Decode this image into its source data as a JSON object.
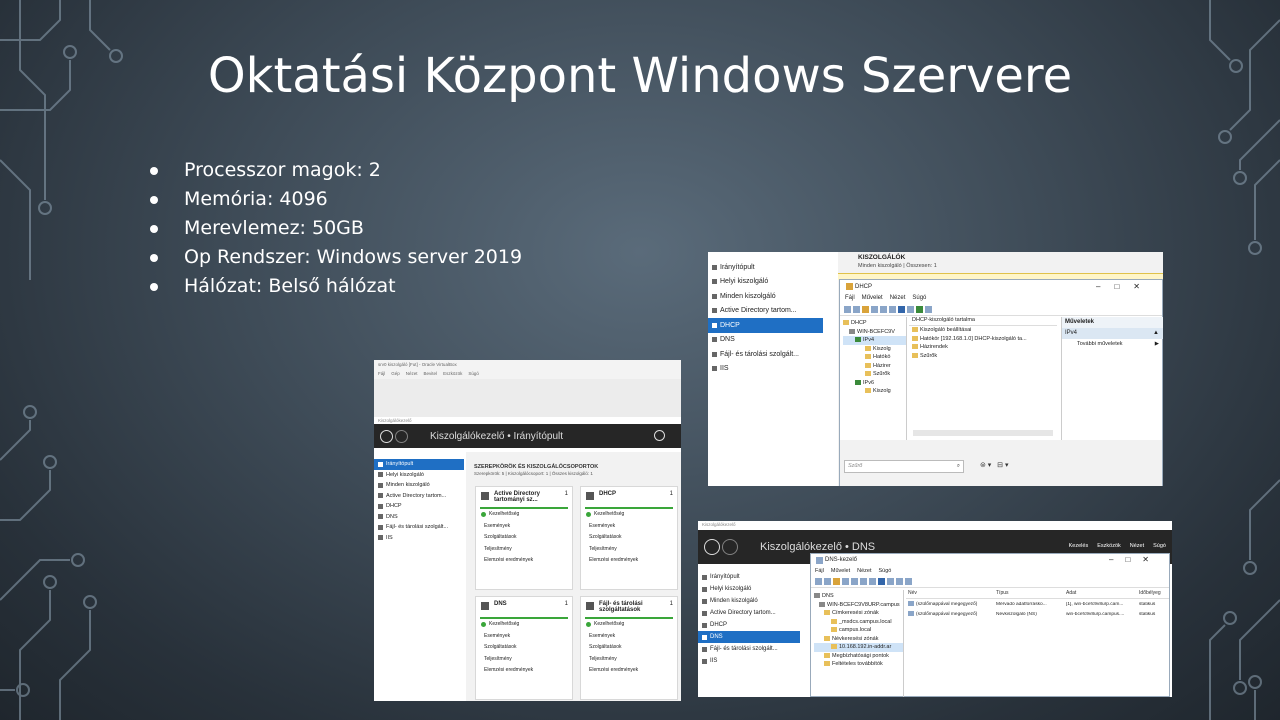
{
  "slide": {
    "title": "Oktatási Központ Windows Szervere",
    "bullets": [
      "Processzor magok: 2",
      "Memória: 4096",
      "Merevlemez: 50GB",
      "Op Rendszer: Windows server 2019",
      "Hálózat: Belső hálózat"
    ]
  },
  "shot1": {
    "vbox_title": "srv0 kiszolgáló [Fut] - Oracle VirtualBox",
    "vbox_menu": [
      "Fájl",
      "Gép",
      "Nézet",
      "Bevitel",
      "Eszközök",
      "Súgó"
    ],
    "sm_title_small": "Kiszolgálókezelő",
    "breadcrumb": "Kiszolgálókezelő • Irányítópult",
    "nav": [
      "Irányítópult",
      "Helyi kiszolgáló",
      "Minden kiszolgáló",
      "Active Directory tartom...",
      "DHCP",
      "DNS",
      "Fájl- és tárolási szolgált...",
      "IIS"
    ],
    "section_title": "SZEREPKÖRÖK ÉS KISZOLGÁLÓCSOPORTOK",
    "section_sub": "Szerepkörök: 5 | Kiszolgálócsoport: 1 | Összes kiszolgáló: 1",
    "tiles": [
      {
        "name": "Active Directory tartományi sz...",
        "count": "1"
      },
      {
        "name": "DHCP",
        "count": "1"
      },
      {
        "name": "DNS",
        "count": "1"
      },
      {
        "name": "Fájl- és tárolási szolgáltatások",
        "count": "1"
      }
    ],
    "tile_rows": [
      "Kezelhetőség",
      "Események",
      "Szolgáltatások",
      "Teljesítmény",
      "Elemzési eredmények"
    ]
  },
  "shot2": {
    "nav": [
      "Irányítópult",
      "Helyi kiszolgáló",
      "Minden kiszolgáló",
      "Active Directory tartom...",
      "DHCP",
      "DNS",
      "Fájl- és tárolási szolgált...",
      "IIS"
    ],
    "header_title": "KISZOLGÁLÓK",
    "header_sub": "Minden kiszolgáló | Összesen: 1",
    "dhcp_title": "DHCP",
    "menu": [
      "Fájl",
      "Művelet",
      "Nézet",
      "Súgó"
    ],
    "tree": [
      "DHCP",
      "WIN-BCEFC9V",
      "IPv4",
      "Kiszolg",
      "Hatókö",
      "Házirer",
      "Szűrők",
      "IPv6",
      "Kiszolg"
    ],
    "content_header": "DHCP-kiszolgáló tartalma",
    "content_rows": [
      "Kiszolgáló beállításai",
      "Hatókör [192.168.1.0] DHCP-kiszolgáló ta...",
      "Házirendek",
      "Szűrők"
    ],
    "actions_header": "Műveletek",
    "actions_sel": "IPv4",
    "actions_more": "További műveletek",
    "filter_placeholder": "Szűrő"
  },
  "shot3": {
    "sm_title_small": "Kiszolgálókezelő",
    "breadcrumb": "Kiszolgálókezelő • DNS",
    "top_menu": [
      "Kezelés",
      "Eszközök",
      "Nézet",
      "Súgó"
    ],
    "nav": [
      "Irányítópult",
      "Helyi kiszolgáló",
      "Minden kiszolgáló",
      "Active Directory tartom...",
      "DHCP",
      "DNS",
      "Fájl- és tárolási szolgált...",
      "IIS"
    ],
    "dns_title": "DNS-kezelő",
    "menu": [
      "Fájl",
      "Művelet",
      "Nézet",
      "Súgó"
    ],
    "tree": [
      "DNS",
      "WIN-BCEFC9V8URP.campus",
      "Címkeresési zónák",
      "_msdcs.campus.local",
      "campus.local",
      "Névkeresési zónák",
      "10.168.192.in-addr.ar",
      "Megbízhatósági pontok",
      "Feltételes továbbítók"
    ],
    "cols": [
      "Név",
      "Típus",
      "Adat",
      "Időbélyeg"
    ],
    "rows": [
      [
        "(szülőmappával megegyező)",
        "Mérvadó adatforrásko...",
        "[1], win-bcefc9v8urp.cam...",
        "statikus"
      ],
      [
        "(szülőmappával megegyező)",
        "Névkiszolgáló (NS)",
        "win-bcefc9v8urp.campus....",
        "statikus"
      ]
    ]
  }
}
